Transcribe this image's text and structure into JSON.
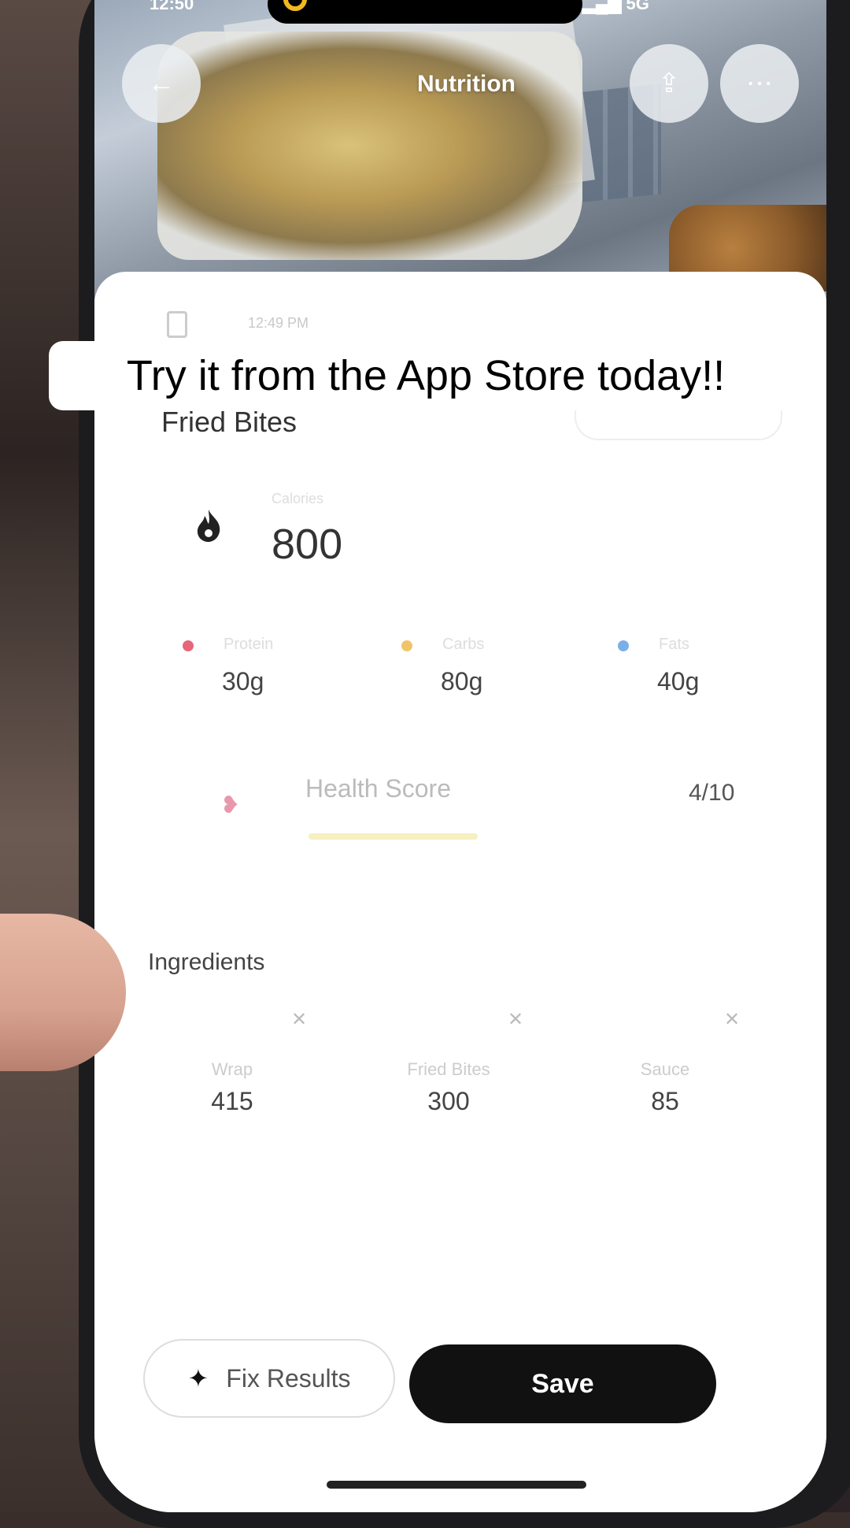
{
  "status_bar": {
    "time": "12:50",
    "network": "5G"
  },
  "header": {
    "title": "Nutrition"
  },
  "meal": {
    "time": "12:49 PM",
    "name": "Fried Bites",
    "calories_label": "Calories",
    "calories": "800"
  },
  "macros": [
    {
      "label": "Protein",
      "value": "30g",
      "color": "#e8667a"
    },
    {
      "label": "Carbs",
      "value": "80g",
      "color": "#f2c46a"
    },
    {
      "label": "Fats",
      "value": "40g",
      "color": "#7ab0e8"
    }
  ],
  "health": {
    "label": "Health Score",
    "value": "4/10",
    "score_fraction": 0.4
  },
  "ingredients": {
    "title": "Ingredients",
    "items": [
      {
        "name": "Wrap",
        "calories": "415"
      },
      {
        "name": "Fried Bites",
        "calories": "300"
      },
      {
        "name": "Sauce",
        "calories": "85"
      }
    ]
  },
  "actions": {
    "fix": "Fix Results",
    "save": "Save"
  },
  "caption": "Try it from the App Store today!!"
}
